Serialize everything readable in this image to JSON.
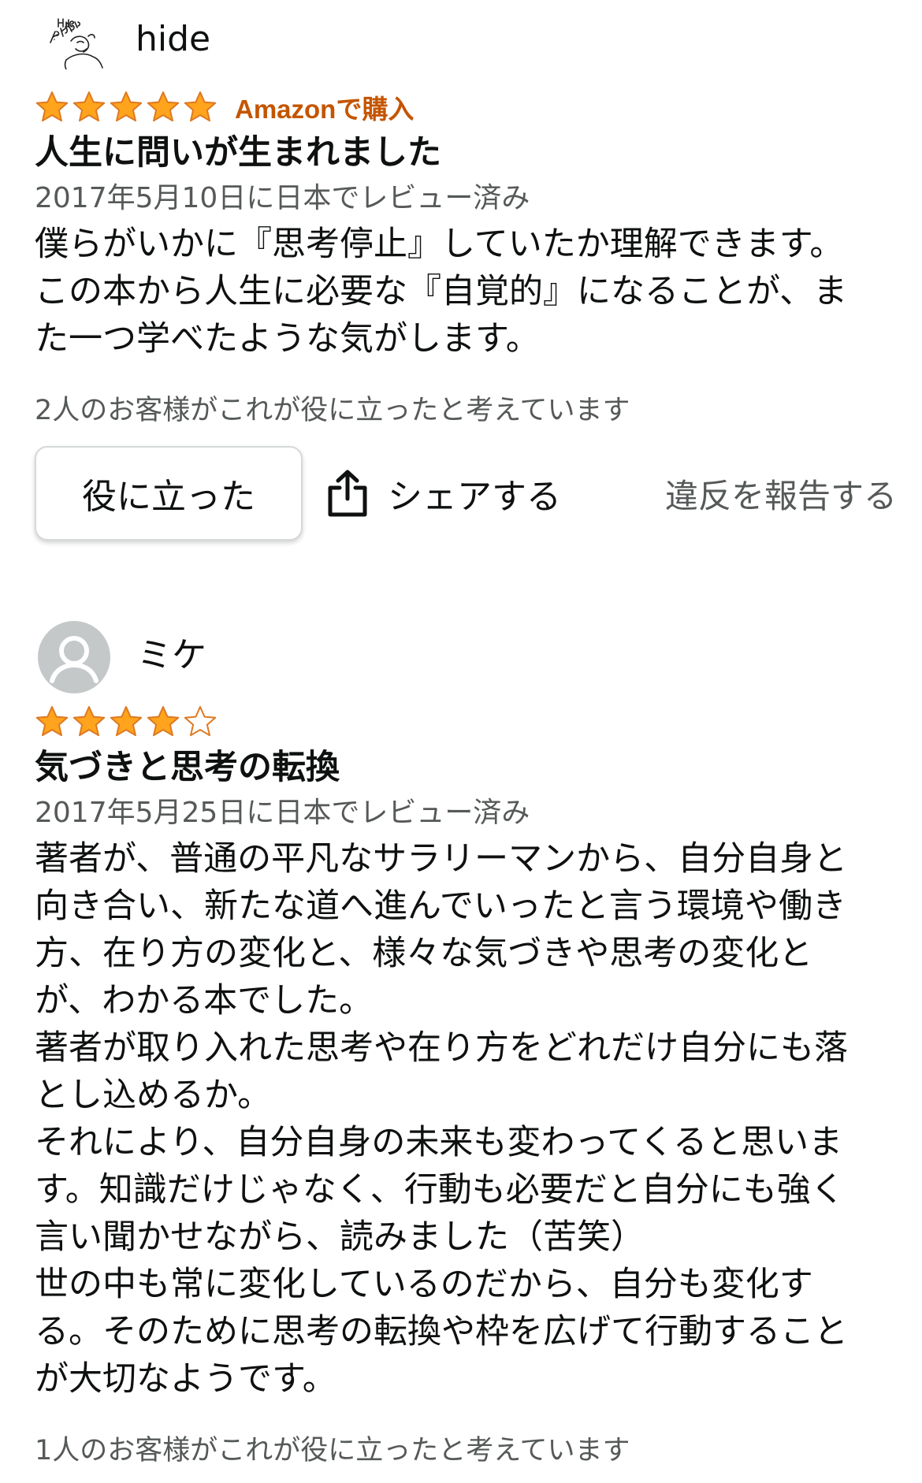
{
  "reviews": [
    {
      "author": "hide",
      "avatar": "hide-kokuban-logo",
      "rating": 5,
      "rating_max": 5,
      "badge": "Amazonで購入",
      "title": "人生に問いが生まれました",
      "date": "2017年5月10日に日本でレビュー済み",
      "body": "僕らがいかに『思考停止』していたか理解できます。\nこの本から人生に必要な『自覚的』になることが、ま\nた一つ学べたような気がします。",
      "helpful_count": "2人のお客様がこれが役に立ったと考えています",
      "helpful_button": "役に立った",
      "share_label": "シェアする",
      "report_label": "違反を報告する"
    },
    {
      "author": "ミケ",
      "avatar": "default-user-icon",
      "rating": 4,
      "rating_max": 5,
      "title": "気づきと思考の転換",
      "date": "2017年5月25日に日本でレビュー済み",
      "body": "著者が、普通の平凡なサラリーマンから、自分自身と\n向き合い、新たな道へ進んでいったと言う環境や働き\n方、在り方の変化と、様々な気づきや思考の変化と\nが、わかる本でした。\n著者が取り入れた思考や在り方をどれだけ自分にも落\nとし込めるか。\nそれにより、自分自身の未来も変わってくると思いま\nす。知識だけじゃなく、行動も必要だと自分にも強く\n言い聞かせながら、読みました（苦笑）\n世の中も常に変化しているのだから、自分も変化す\nる。そのために思考の転換や枠を広げて行動すること\nが大切なようです。",
      "helpful_count": "1人のお客様がこれが役に立ったと考えています"
    }
  ],
  "colors": {
    "star_fill": "#ffa41c",
    "star_stroke": "#de7921",
    "badge": "#c45500",
    "secondary_text": "#565959",
    "primary_text": "#0f1111"
  }
}
